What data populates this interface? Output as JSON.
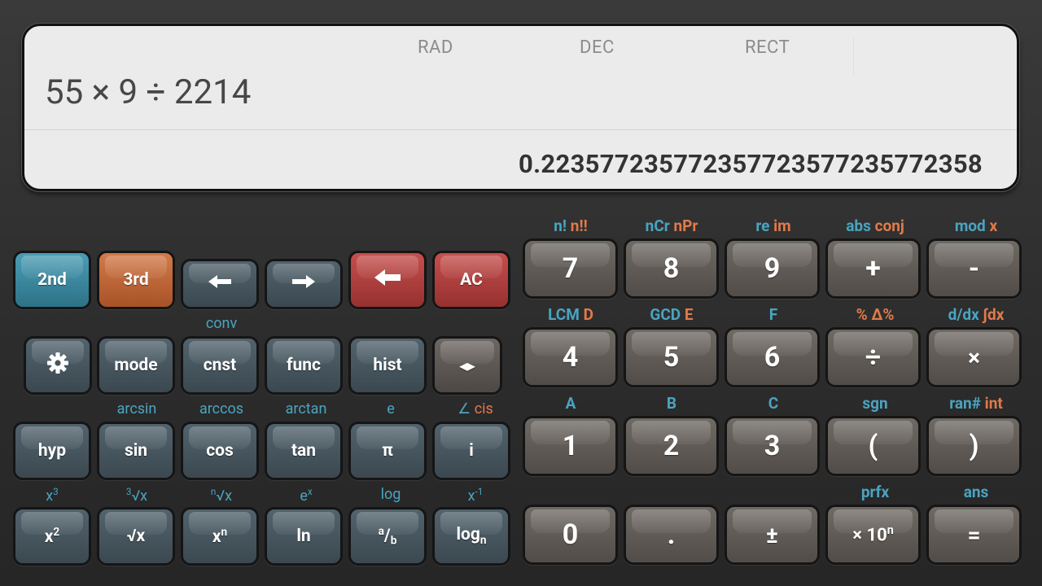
{
  "display": {
    "angle_mode": "RAD",
    "number_base": "DEC",
    "coord_mode": "RECT",
    "expression": "55 × 9 ÷ 2214",
    "result": "0.223577235772357723577235772358"
  },
  "colors": {
    "secondary_label": "#4aa4c0",
    "tertiary_label": "#e07a4b",
    "key_2nd": "#3b8ca5",
    "key_3rd": "#c0683a",
    "key_delete": "#b44543",
    "display_bg": "#ebebeb"
  },
  "left_keys": {
    "row1": {
      "second": "2nd",
      "third": "3rd",
      "cursor_left": "←",
      "cursor_right": "→",
      "backspace_icon": "backspace-arrow",
      "clear": "AC"
    },
    "row2": {
      "settings_icon": "gear",
      "mode": "mode",
      "cnst": "cnst",
      "cnst_second": "conv",
      "func": "func",
      "hist": "hist",
      "lr_icon": "◂▸"
    },
    "row3": {
      "hyp": "hyp",
      "sin": "sin",
      "sin_second": "arcsin",
      "cos": "cos",
      "cos_second": "arccos",
      "tan": "tan",
      "tan_second": "arctan",
      "pi": "π",
      "pi_second": "e",
      "i": "i",
      "i_second": "∠",
      "i_third": "cis"
    },
    "row4": {
      "square_base": "x",
      "square_exp": "2",
      "square_second_base": "x",
      "square_second_exp": "3",
      "sqrt": "√x",
      "sqrt_second_pre": "3",
      "sqrt_second": "√x",
      "power_base": "x",
      "power_exp": "n",
      "power_second_pre": "n",
      "power_second": "√x",
      "ln": "ln",
      "ln_second_base": "e",
      "ln_second_exp": "x",
      "frac_num": "a",
      "frac_slash": "/",
      "frac_den": "b",
      "frac_second": "log",
      "logn_base": "log",
      "logn_sub": "n",
      "logn_second_base": "x",
      "logn_second_exp": "-1"
    }
  },
  "right_keys": {
    "row1": {
      "seven": "7",
      "seven_second": "n!",
      "seven_third": "n!!",
      "eight": "8",
      "eight_second": "nCr",
      "eight_third": "nPr",
      "nine": "9",
      "nine_second": "re",
      "nine_third": "im",
      "plus": "+",
      "plus_second": "abs",
      "plus_third": "conj",
      "minus": "-",
      "minus_second": "mod",
      "minus_third": "x"
    },
    "row2": {
      "four": "4",
      "four_second": "LCM",
      "four_third": "D",
      "five": "5",
      "five_second": "GCD",
      "five_third": "E",
      "six": "6",
      "six_second": "F",
      "divide": "÷",
      "divide_second": "%",
      "divide_third": "Δ%",
      "multiply": "×",
      "multiply_second": "d/dx",
      "multiply_third": "∫dx"
    },
    "row3": {
      "one": "1",
      "one_second": "A",
      "two": "2",
      "two_second": "B",
      "three": "3",
      "three_second": "C",
      "lparen": "(",
      "lparen_second": "sgn",
      "rparen": ")",
      "rparen_second": "ran#",
      "rparen_third": "int"
    },
    "row4": {
      "zero": "0",
      "dot": ".",
      "plusminus": "±",
      "exp_base": "× 10",
      "exp_sup": "n",
      "exp_second": "prfx",
      "equals": "=",
      "equals_second": "ans"
    }
  }
}
